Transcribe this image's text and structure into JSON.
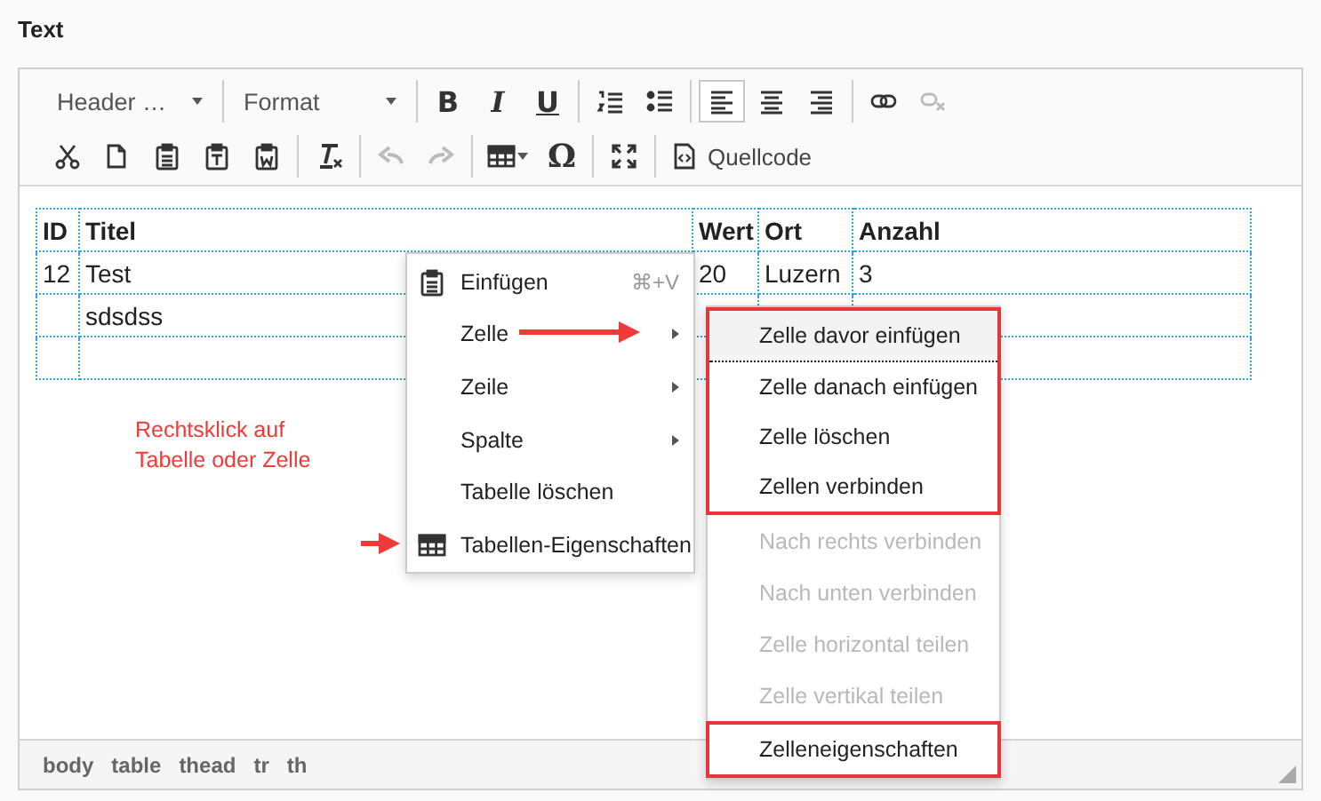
{
  "heading": "Text",
  "toolbar": {
    "rows": [
      [
        [
          {
            "kind": "dropdown",
            "label": "Header …"
          }
        ],
        [
          {
            "kind": "dropdown",
            "label": "Format"
          }
        ],
        [
          {
            "kind": "bold",
            "glyph": "B"
          },
          {
            "kind": "italic",
            "glyph": "I"
          },
          {
            "kind": "underline",
            "glyph": "U"
          }
        ],
        [
          {
            "kind": "numlist"
          },
          {
            "kind": "bullist"
          }
        ],
        [
          {
            "kind": "alignleft",
            "selected": true
          },
          {
            "kind": "aligncenter",
            "selected": false
          },
          {
            "kind": "alignright",
            "selected": false
          }
        ],
        [
          {
            "kind": "link",
            "disabled": false
          },
          {
            "kind": "unlink",
            "disabled": true
          }
        ]
      ],
      [
        [
          {
            "kind": "cut"
          },
          {
            "kind": "copy"
          },
          {
            "kind": "paste"
          },
          {
            "kind": "pastetext"
          },
          {
            "kind": "pasteword"
          }
        ],
        [
          {
            "kind": "removeformat"
          }
        ],
        [
          {
            "kind": "undo",
            "disabled": true
          },
          {
            "kind": "redo",
            "disabled": true
          }
        ],
        [
          {
            "kind": "table"
          },
          {
            "kind": "symbol",
            "glyph": "Ω"
          }
        ],
        [
          {
            "kind": "fullscreen"
          }
        ],
        [
          {
            "kind": "source",
            "label": "Quellcode"
          }
        ]
      ]
    ]
  },
  "table": {
    "columns": [
      "ID",
      "Titel",
      "Wert",
      "Ort",
      "Anzahl"
    ],
    "rows": [
      [
        "12",
        "Test",
        "20",
        "Luzern",
        "3"
      ],
      [
        null,
        "sdsdss",
        null,
        null,
        null
      ],
      [
        null,
        null,
        null,
        null,
        null
      ]
    ]
  },
  "note": [
    "Rechtsklick auf",
    "Tabelle oder Zelle"
  ],
  "context_menu": {
    "items": [
      {
        "kind": "paste",
        "label": "Einfügen",
        "shortcut": "⌘+V"
      },
      {
        "kind": "submenu",
        "label": "Zelle",
        "annotated": true
      },
      {
        "kind": "submenu",
        "label": "Zeile",
        "annotated": false
      },
      {
        "kind": "submenu",
        "label": "Spalte",
        "annotated": false
      },
      {
        "kind": "plain",
        "label": "Tabelle löschen"
      },
      {
        "kind": "table",
        "label": "Tabellen-Eigenschaften",
        "annotated": true
      }
    ]
  },
  "submenu": {
    "items": [
      {
        "label": "Zelle davor einfügen",
        "selected": true,
        "disabled": false,
        "highlighted": true
      },
      {
        "label": "Zelle danach einfügen",
        "selected": false,
        "disabled": false,
        "highlighted": true
      },
      {
        "label": "Zelle löschen",
        "selected": false,
        "disabled": false,
        "highlighted": true
      },
      {
        "label": "Zellen verbinden",
        "selected": false,
        "disabled": false,
        "highlighted": true
      },
      {
        "label": "Nach rechts verbinden",
        "selected": false,
        "disabled": true,
        "highlighted": false
      },
      {
        "label": "Nach unten verbinden",
        "selected": false,
        "disabled": true,
        "highlighted": false
      },
      {
        "label": "Zelle horizontal teilen",
        "selected": false,
        "disabled": true,
        "highlighted": false
      },
      {
        "label": "Zelle vertikal teilen",
        "selected": false,
        "disabled": true,
        "highlighted": false
      },
      {
        "label": "Zelleneigenschaften",
        "selected": false,
        "disabled": false,
        "highlighted": true
      }
    ]
  },
  "status_bar": {
    "path": [
      "body",
      "table",
      "thead",
      "tr",
      "th"
    ]
  }
}
